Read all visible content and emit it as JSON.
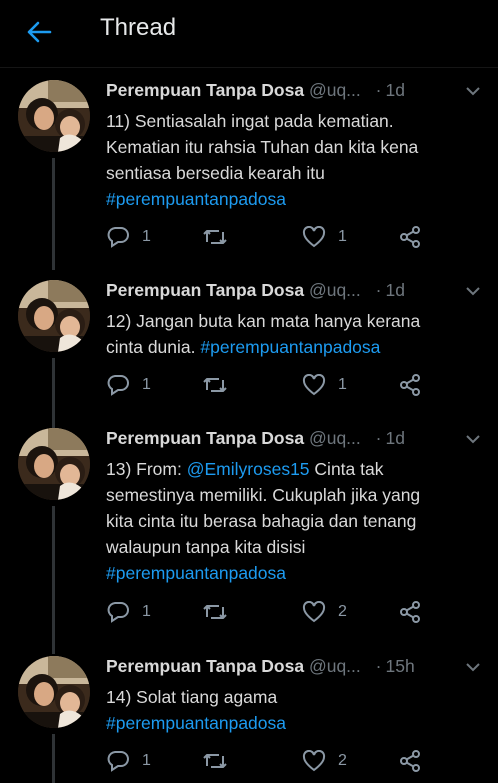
{
  "header": {
    "title": "Thread"
  },
  "tweets": [
    {
      "name": "Perempuan Tanpa Dosa",
      "handle": "@uq...",
      "sep": "·",
      "time": "1d",
      "lines": [
        "11) Sentiasalah ingat pada kematian.",
        "Kematian itu rahsia Tuhan dan kita kena",
        "sentiasa bersedia kearah itu"
      ],
      "hashtag": "#perempuantanpadosa",
      "replies": "1",
      "likes": "1"
    },
    {
      "name": "Perempuan Tanpa Dosa",
      "handle": "@uq...",
      "sep": "·",
      "time": "1d",
      "line1": "12) Jangan buta kan mata hanya kerana",
      "line2_text": "cinta dunia.",
      "hashtag": "#perempuantanpadosa",
      "replies": "1",
      "likes": "1"
    },
    {
      "name": "Perempuan Tanpa Dosa",
      "handle": "@uq...",
      "sep": "·",
      "time": "1d",
      "line1_prefix": "13) From:",
      "mention": "@Emilyroses15",
      "line1_suffix": "Cinta tak",
      "lines": [
        "semestinya memiliki. Cukuplah jika yang",
        "kita cinta itu berasa bahagia dan tenang",
        "walaupun tanpa kita disisi"
      ],
      "hashtag": "#perempuantanpadosa",
      "replies": "1",
      "likes": "2"
    },
    {
      "name": "Perempuan Tanpa Dosa",
      "handle": "@uq...",
      "sep": "·",
      "time": "15h",
      "line1": "14) Solat tiang agama",
      "hashtag": "#perempuantanpadosa",
      "replies": "1",
      "likes": "2"
    }
  ],
  "colors": {
    "background": "#000000",
    "link": "#1d9bf0",
    "muted": "#6e767d",
    "text": "#d9d9d9"
  },
  "icons": [
    "back-arrow-icon",
    "reply-icon",
    "retweet-icon",
    "like-icon",
    "share-icon",
    "caret-down-icon"
  ]
}
